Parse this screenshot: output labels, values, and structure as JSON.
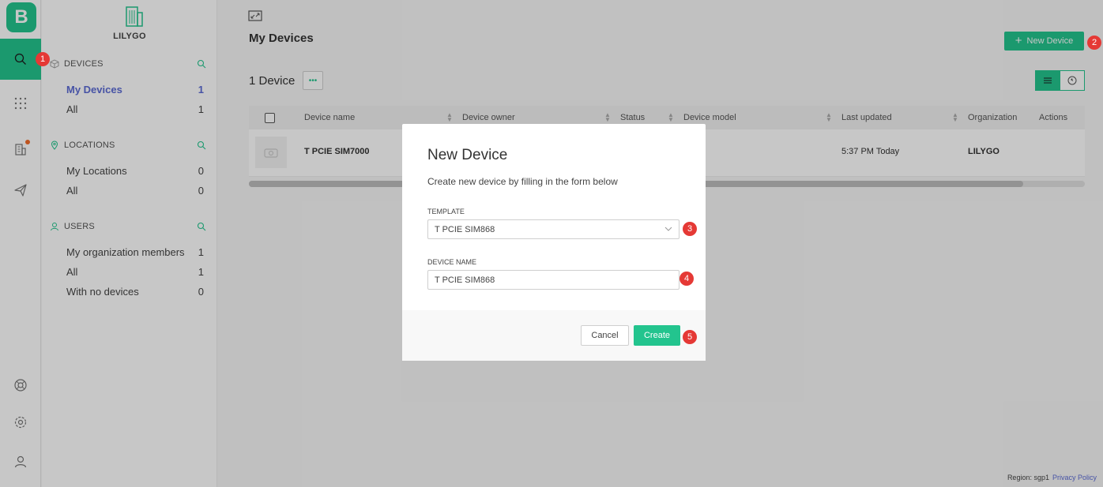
{
  "brand": {
    "logo_letter": "B",
    "accent": "#23c48e"
  },
  "rail": [
    {
      "icon": "search-icon",
      "active": true
    },
    {
      "icon": "apps-grid-icon"
    },
    {
      "icon": "building-icon",
      "badge": true
    },
    {
      "icon": "send-icon"
    },
    {
      "icon": "help-icon"
    },
    {
      "icon": "settings-icon"
    },
    {
      "icon": "user-icon"
    }
  ],
  "sidebar": {
    "org_name": "LILYGO",
    "devices": {
      "title": "DEVICES",
      "items": [
        {
          "label": "My Devices",
          "count": "1"
        },
        {
          "label": "All",
          "count": "1"
        }
      ]
    },
    "locations": {
      "title": "LOCATIONS",
      "items": [
        {
          "label": "My Locations",
          "count": "0"
        },
        {
          "label": "All",
          "count": "0"
        }
      ]
    },
    "users": {
      "title": "USERS",
      "items": [
        {
          "label": "My organization members",
          "count": "1"
        },
        {
          "label": "All",
          "count": "1"
        },
        {
          "label": "With no devices",
          "count": "0"
        }
      ]
    }
  },
  "main": {
    "title": "My Devices",
    "new_device_label": "New Device",
    "count_label": "1 Device",
    "columns": [
      "Device name",
      "Device owner",
      "Status",
      "Device model",
      "Last updated",
      "Organization",
      "Actions"
    ],
    "rows": [
      {
        "name": "T PCIE SIM7000",
        "last_updated": "5:37 PM Today",
        "organization": "LILYGO"
      }
    ]
  },
  "modal": {
    "title": "New Device",
    "subtitle": "Create new device by filling in the form below",
    "template_label": "TEMPLATE",
    "template_value": "T PCIE SIM868",
    "device_name_label": "DEVICE NAME",
    "device_name_value": "T PCIE SIM868",
    "cancel_label": "Cancel",
    "create_label": "Create"
  },
  "markers": [
    "1",
    "2",
    "3",
    "4",
    "5"
  ],
  "footer": {
    "region": "Region: sgp1",
    "privacy": "Privacy Policy"
  }
}
